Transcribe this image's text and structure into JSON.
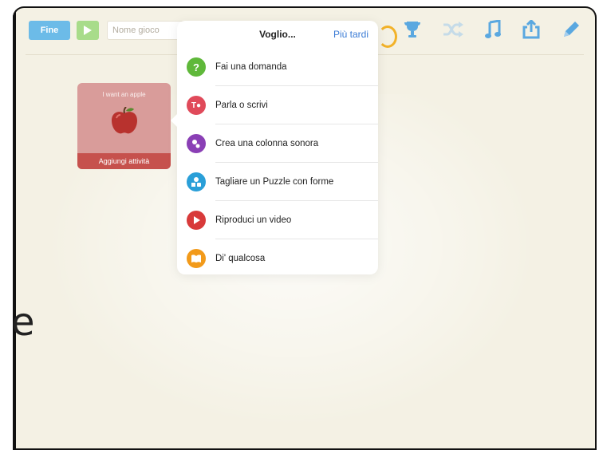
{
  "toolbar": {
    "done_label": "Fine",
    "game_name_placeholder": "Nome gioco",
    "icons": [
      "play-icon",
      "trophy-icon",
      "shuffle-icon",
      "music-note-icon",
      "share-icon",
      "pencil-icon"
    ]
  },
  "card": {
    "title": "I want an apple",
    "footer": "Aggiungi attività",
    "image": "apple-image"
  },
  "popover": {
    "title": "Voglio...",
    "later_label": "Più tardi",
    "items": [
      {
        "label": "Fai una domanda",
        "icon": "question-icon",
        "color": "#5fb83a"
      },
      {
        "label": "Parla o scrivi",
        "icon": "text-mic-icon",
        "color": "#e04a5a"
      },
      {
        "label": "Crea una colonna sonora",
        "icon": "music-notes-icon",
        "color": "#8a3fb5"
      },
      {
        "label": "Tagliare un Puzzle con forme",
        "icon": "shapes-icon",
        "color": "#2a9fd8"
      },
      {
        "label": "Riproduci un video",
        "icon": "play-video-icon",
        "color": "#d83a3a"
      },
      {
        "label": "Di' qualcosa",
        "icon": "book-icon",
        "color": "#f29a1a"
      }
    ]
  },
  "colors": {
    "background": "#f4f1e4",
    "accent_blue": "#6cbbe8",
    "link_blue": "#3a7bd5",
    "card_pink": "#d99c9a",
    "card_red": "#c6514d",
    "icon_blue": "#5aa8e0"
  },
  "edge_text": "e"
}
